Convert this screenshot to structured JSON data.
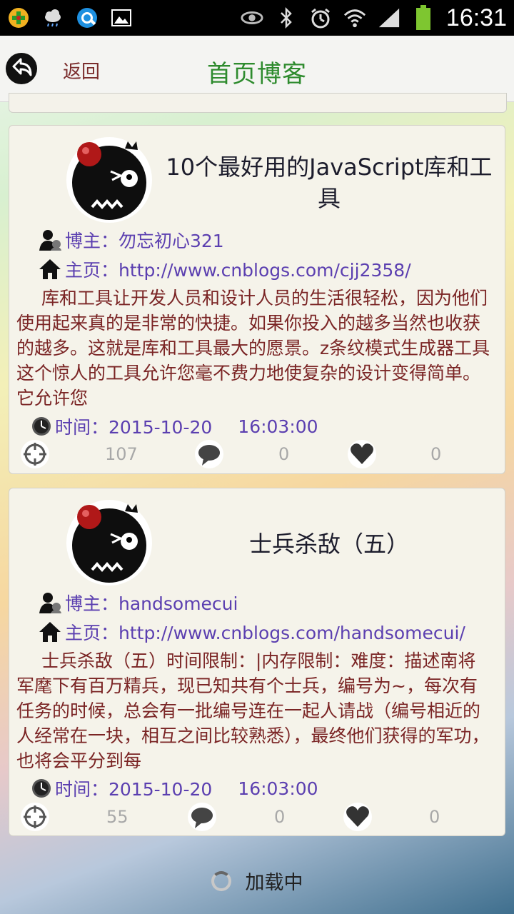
{
  "status_bar": {
    "time": "16:31",
    "left_icons": [
      "game-icon",
      "weather-icon",
      "browser-icon",
      "gallery-icon"
    ],
    "right_icons": [
      "eye-icon",
      "bluetooth-icon",
      "alarm-icon",
      "wifi-icon",
      "signal-icon",
      "battery-icon"
    ]
  },
  "header": {
    "back_label": "返回",
    "title": "首页博客"
  },
  "posts": [
    {
      "title": "10个最好用的JavaScript库和工具",
      "author_label": "博主：勿忘初心321",
      "home_label": "主页：http://www.cnblogs.com/cjj2358/",
      "summary": "库和工具让开发人员和设计人员的生活很轻松，因为他们使用起来真的是非常的快捷。如果你投入的越多当然也收获的越多。这就是库和工具最大的愿景。z条纹模式生成器工具这个惊人的工具允许您毫不费力地使复杂的设计变得简单。它允许您",
      "time_label": "时间：2015-10-20",
      "time_clock": "16:03:00",
      "views": "107",
      "comments": "0",
      "likes": "0"
    },
    {
      "title": "士兵杀敌（五）",
      "author_label": "博主：handsomecui",
      "home_label": "主页：http://www.cnblogs.com/handsomecui/",
      "summary": "士兵杀敌（五）时间限制：|内存限制：难度：描述南将军麾下有百万精兵，现已知共有个士兵，编号为~，每次有任务的时候，总会有一批编号连在一起人请战（编号相近的人经常在一块，相互之间比较熟悉），最终他们获得的军功，也将会平分到每",
      "time_label": "时间：2015-10-20",
      "time_clock": "16:03:00",
      "views": "55",
      "comments": "0",
      "likes": "0"
    }
  ],
  "footer": {
    "loading_text": "加载中"
  }
}
